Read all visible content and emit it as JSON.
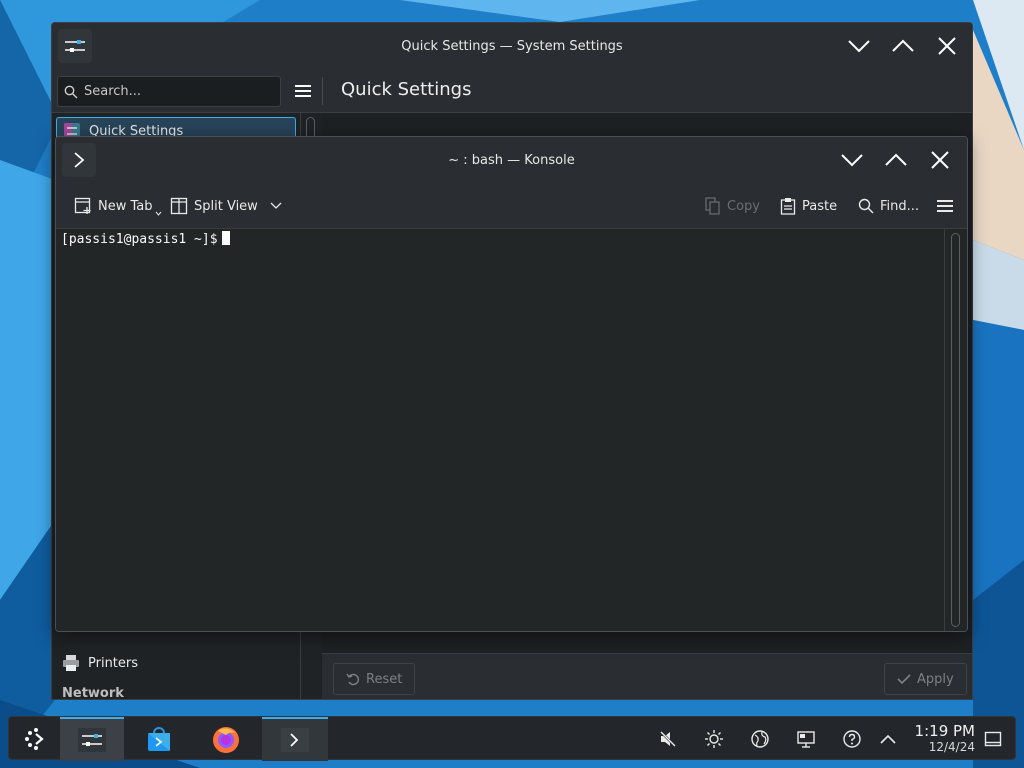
{
  "settings_window": {
    "title": "Quick Settings — System Settings",
    "search_placeholder": "Search...",
    "page_title": "Quick Settings",
    "sidebar_items": [
      {
        "label": "Quick Settings",
        "active": true
      },
      {
        "label": "Printers",
        "active": false
      },
      {
        "label": "Network",
        "active": false
      }
    ],
    "reset_label": "Reset",
    "apply_label": "Apply"
  },
  "konsole_window": {
    "title": "~ : bash — Konsole",
    "toolbar": {
      "new_tab": "New Tab",
      "split_view": "Split View",
      "copy": "Copy",
      "paste": "Paste",
      "find": "Find..."
    },
    "prompt": "[passis1@passis1 ~]$"
  },
  "taskbar": {
    "apps": [
      "app-launcher",
      "system-settings",
      "discover",
      "firefox",
      "konsole"
    ],
    "tray_icons": [
      "volume-muted-icon",
      "brightness-icon",
      "network-icon",
      "display-icon",
      "help-icon",
      "show-hidden-icon"
    ],
    "clock_time": "1:19 PM",
    "clock_date": "12/4/24"
  },
  "colors": {
    "accent": "#3daee9",
    "window_bg": "#202326",
    "terminal_bg": "#232627"
  }
}
